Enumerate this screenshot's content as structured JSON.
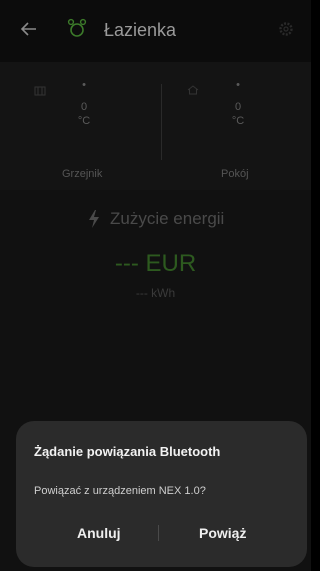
{
  "header": {
    "title": "Łazienka",
    "icons": [
      "back-arrow-icon",
      "app-logo-icon",
      "settings-gear-icon"
    ]
  },
  "heater": {
    "dot": "•",
    "value": "0",
    "unit": "°C",
    "label": "Grzejnik"
  },
  "room": {
    "dot": "•",
    "value": "0",
    "unit": "°C",
    "label": "Pokój"
  },
  "energy": {
    "title": "Zużycie energii",
    "cost": "--- EUR",
    "kwh": "--- kWh",
    "accent": "#2d5a1f"
  },
  "dialog": {
    "title": "Żądanie powiązania Bluetooth",
    "message": "Powiązać z urządzeniem NEX 1.0?",
    "cancel_label": "Anuluj",
    "pair_label": "Powiąż"
  }
}
